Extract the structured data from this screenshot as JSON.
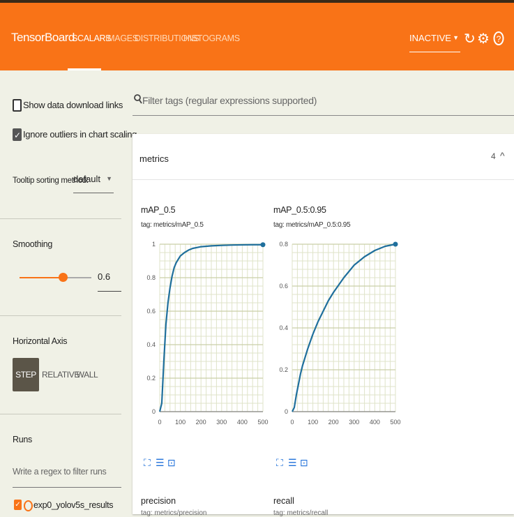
{
  "app": {
    "title": "TensorBoard"
  },
  "nav": {
    "tabs": [
      {
        "label": "SCALARS",
        "active": true
      },
      {
        "label": "IMAGES",
        "active": false
      },
      {
        "label": "DISTRIBUTIONS",
        "active": false
      },
      {
        "label": "HISTOGRAMS",
        "active": false
      }
    ],
    "status_select": "INACTIVE",
    "icons": [
      "refresh-icon",
      "gear-icon",
      "help-icon"
    ]
  },
  "colors": {
    "accent": "#f97317",
    "line": "#1f6f9c",
    "button_active": "#5b5548"
  },
  "sidebar": {
    "show_download_links": {
      "label": "Show data download links",
      "checked": false
    },
    "ignore_outliers": {
      "label": "Ignore outliers in chart scaling",
      "checked": true
    },
    "tooltip_sorting": {
      "label": "Tooltip sorting method:",
      "value": "default"
    },
    "smoothing": {
      "label": "Smoothing",
      "value": "0.6",
      "level": 0.6
    },
    "horizontal_axis": {
      "label": "Horizontal Axis",
      "options": [
        {
          "label": "STEP",
          "active": true
        },
        {
          "label": "RELATIVE",
          "active": false
        },
        {
          "label": "WALL",
          "active": false
        }
      ]
    },
    "runs": {
      "label": "Runs",
      "filter_placeholder": "Write a regex to filter runs",
      "items": [
        {
          "label": "exp0_yolov5s_results",
          "checked": true
        }
      ]
    }
  },
  "main": {
    "filter_placeholder": "Filter tags (regular expressions supported)",
    "group": {
      "name": "metrics",
      "count": "4"
    },
    "lower_cards": [
      {
        "title": "precision",
        "tag": "tag: metrics/precision"
      },
      {
        "title": "recall",
        "tag": "tag: metrics/recall"
      }
    ]
  },
  "chart_data": [
    {
      "type": "line",
      "title": "mAP_0.5",
      "subtitle": "tag: metrics/mAP_0.5",
      "xlim": [
        0,
        500
      ],
      "ylim": [
        0,
        1
      ],
      "xticks": [
        "0",
        "100",
        "200",
        "300",
        "400",
        "500"
      ],
      "yticks": [
        "0",
        "0.2",
        "0.4",
        "0.6",
        "0.8",
        "1"
      ],
      "grid": true,
      "x": [
        0,
        10,
        20,
        30,
        40,
        50,
        60,
        70,
        80,
        100,
        120,
        140,
        160,
        180,
        200,
        250,
        300,
        350,
        400,
        450,
        500
      ],
      "y": [
        0,
        0.05,
        0.3,
        0.52,
        0.65,
        0.74,
        0.81,
        0.86,
        0.89,
        0.93,
        0.95,
        0.965,
        0.975,
        0.98,
        0.985,
        0.99,
        0.993,
        0.995,
        0.996,
        0.997,
        0.997
      ]
    },
    {
      "type": "line",
      "title": "mAP_0.5:0.95",
      "subtitle": "tag: metrics/mAP_0.5:0.95",
      "xlim": [
        0,
        500
      ],
      "ylim": [
        0,
        0.8
      ],
      "xticks": [
        "0",
        "100",
        "200",
        "300",
        "400",
        "500"
      ],
      "yticks": [
        "0",
        "0.2",
        "0.4",
        "0.6",
        "0.8"
      ],
      "grid": true,
      "x": [
        0,
        10,
        20,
        30,
        40,
        50,
        75,
        100,
        125,
        150,
        175,
        200,
        250,
        300,
        350,
        400,
        450,
        500
      ],
      "y": [
        0,
        0.02,
        0.08,
        0.13,
        0.18,
        0.22,
        0.3,
        0.37,
        0.43,
        0.48,
        0.53,
        0.57,
        0.64,
        0.7,
        0.74,
        0.77,
        0.79,
        0.8
      ]
    }
  ]
}
